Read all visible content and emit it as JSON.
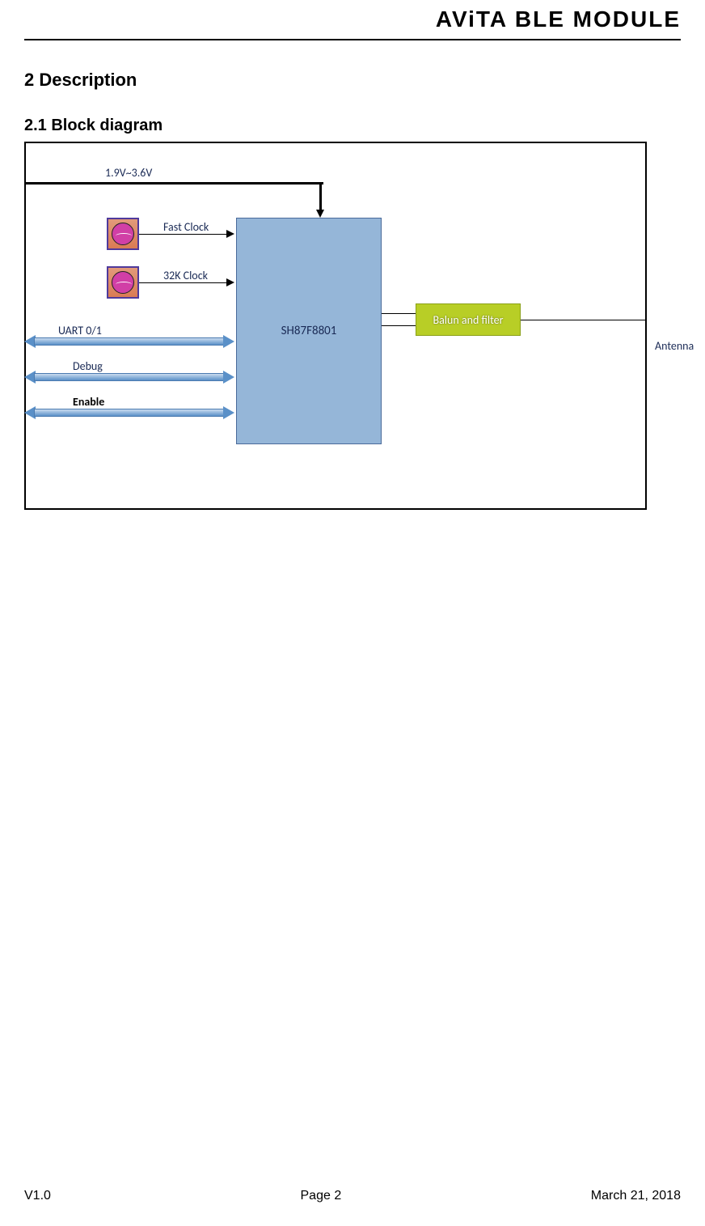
{
  "header": {
    "title": "AViTA  BLE  MODULE"
  },
  "section": {
    "h2": "2 Description",
    "h3": "2.1 Block diagram"
  },
  "diagram": {
    "voltage": "1.9V~3.6V",
    "fast_clock": "Fast Clock",
    "k32_clock": "32K Clock",
    "mcu": "SH87F8801",
    "uart": "UART   0/1",
    "debug": "Debug",
    "enable": "Enable",
    "balun": "Balun and filter",
    "antenna": "Antenna"
  },
  "footer": {
    "version": "V1.0",
    "page": "Page 2",
    "date": "March 21, 2018"
  }
}
